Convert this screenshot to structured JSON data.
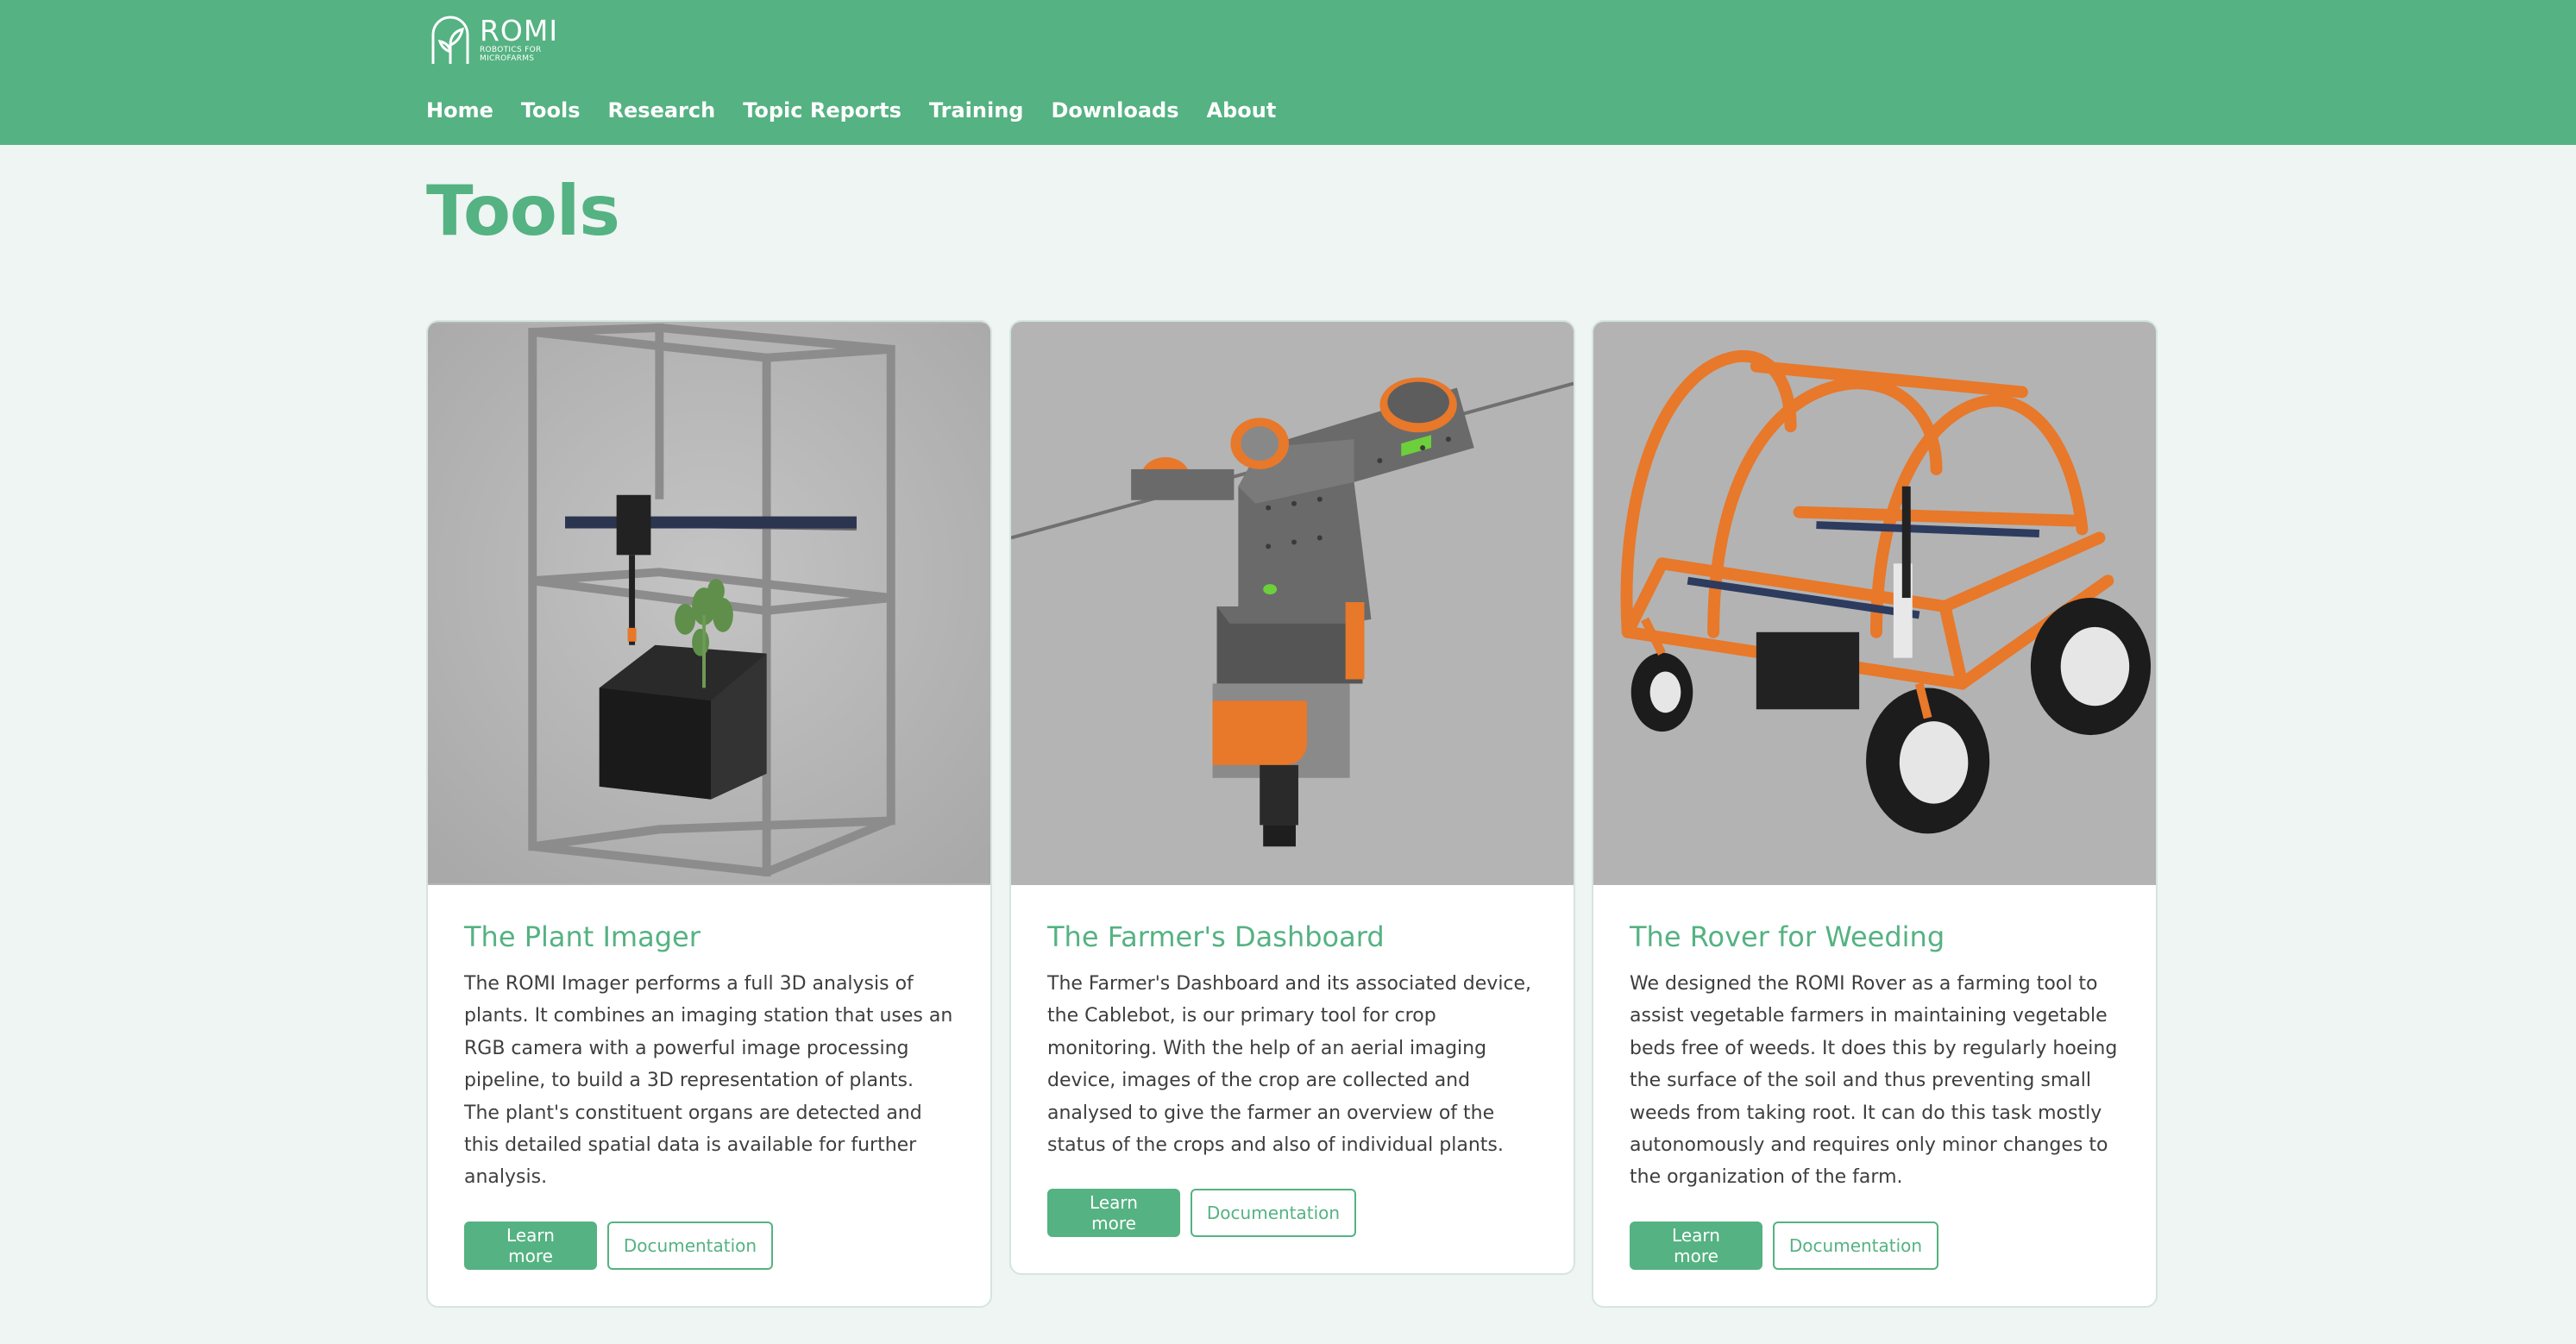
{
  "logo": {
    "name": "ROMI",
    "subtitle_line1": "ROBOTICS FOR",
    "subtitle_line2": "MICROFARMS",
    "icon": "sprout-arch-icon"
  },
  "nav": {
    "items": [
      {
        "label": "Home"
      },
      {
        "label": "Tools"
      },
      {
        "label": "Research"
      },
      {
        "label": "Topic Reports"
      },
      {
        "label": "Training"
      },
      {
        "label": "Downloads"
      },
      {
        "label": "About"
      }
    ]
  },
  "page": {
    "title": "Tools"
  },
  "colors": {
    "brand": "#55b282",
    "background": "#eef5f2",
    "orange": "#e8782a"
  },
  "cards": [
    {
      "title": "The Plant Imager",
      "text": "The ROMI Imager performs a full 3D analysis of plants. It combines an imaging station that uses an RGB camera with a powerful image processing pipeline, to build a 3D representation of plants. The plant's constituent organs are detected and this detailed spatial data is available for further analysis.",
      "primary_label": "Learn more",
      "secondary_label": "Documentation",
      "image": "plant-imager-render"
    },
    {
      "title": "The Farmer's Dashboard",
      "text": "The Farmer's Dashboard and its associated device, the Cablebot, is our primary tool for crop monitoring. With the help of an aerial imaging device, images of the crop are collected and analysed to give the farmer an overview of the status of the crops and also of individual plants.",
      "primary_label": "Learn more",
      "secondary_label": "Documentation",
      "image": "cablebot-render"
    },
    {
      "title": "The Rover for Weeding",
      "text": "We designed the ROMI Rover as a farming tool to assist vegetable farmers in maintaining vegetable beds free of weeds. It does this by regularly hoeing the surface of the soil and thus preventing small weeds from taking root. It can do this task mostly autonomously and requires only minor changes to the organization of the farm.",
      "primary_label": "Learn more",
      "secondary_label": "Documentation",
      "image": "rover-render"
    }
  ]
}
